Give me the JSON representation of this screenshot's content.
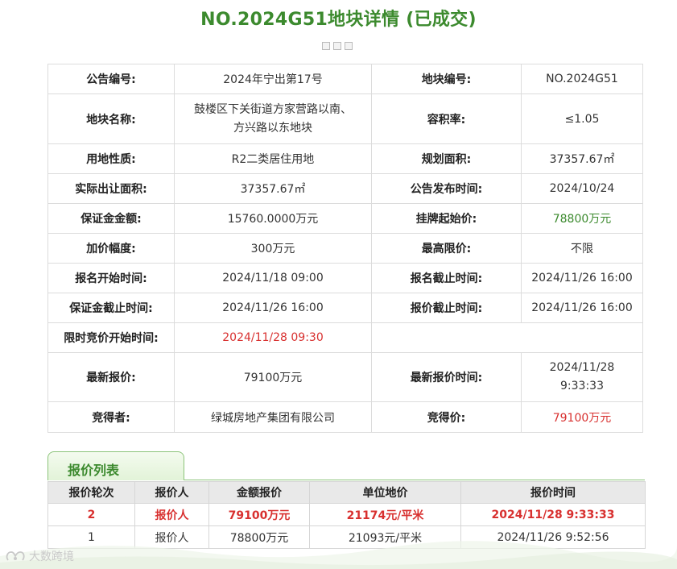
{
  "page_title": "NO.2024G51地块详情 (已成交)",
  "details": [
    {
      "l1": "公告编号:",
      "v1": "2024年宁出第17号",
      "l2": "地块编号:",
      "v2": "NO.2024G51"
    },
    {
      "l1": "地块名称:",
      "v1": "鼓楼区下关街道方家营路以南、方兴路以东地块",
      "l2": "容积率:",
      "v2": "≤1.05"
    },
    {
      "l1": "用地性质:",
      "v1": "R2二类居住用地",
      "l2": "规划面积:",
      "v2": "37357.67㎡"
    },
    {
      "l1": "实际出让面积:",
      "v1": "37357.67㎡",
      "l2": "公告发布时间:",
      "v2": "2024/10/24"
    },
    {
      "l1": "保证金金额:",
      "v1": "15760.0000万元",
      "l2": "挂牌起始价:",
      "v2": "78800万元"
    },
    {
      "l1": "加价幅度:",
      "v1": "300万元",
      "l2": "最高限价:",
      "v2": "不限"
    },
    {
      "l1": "报名开始时间:",
      "v1": "2024/11/18 09:00",
      "l2": "报名截止时间:",
      "v2": "2024/11/26 16:00"
    },
    {
      "l1": "保证金截止时间:",
      "v1": "2024/11/26 16:00",
      "l2": "报价截止时间:",
      "v2": "2024/11/26 16:00"
    },
    {
      "l1": "限时竞价开始时间:",
      "v1": "2024/11/28 09:30",
      "l2": "",
      "v2": ""
    },
    {
      "l1": "最新报价:",
      "v1": "79100万元",
      "l2": "最新报价时间:",
      "v2": "2024/11/28 9:33:33"
    },
    {
      "l1": "竞得者:",
      "v1": "绿城房地产集团有限公司",
      "l2": "竞得价:",
      "v2": "79100万元"
    }
  ],
  "bid_section": {
    "tab_label": "报价列表",
    "headers": [
      "报价轮次",
      "报价人",
      "金额报价",
      "单位地价",
      "报价时间"
    ],
    "rows": [
      [
        "2",
        "报价人",
        "79100万元",
        "21174元/平米",
        "2024/11/28 9:33:33"
      ],
      [
        "1",
        "报价人",
        "78800万元",
        "21093元/平米",
        "2024/11/26 9:52:56"
      ]
    ]
  },
  "watermark": "大数跨境",
  "colors": {
    "accent_green": "#3c8a2e",
    "highlight_red": "#d8302f"
  }
}
